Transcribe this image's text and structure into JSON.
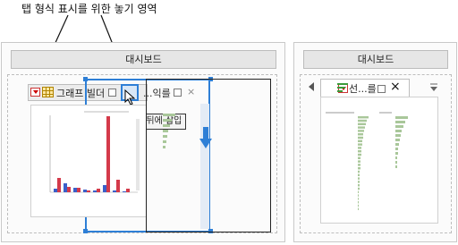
{
  "callout": {
    "text": "탭 형식 표시를 위한 놓기 영역"
  },
  "left_panel": {
    "title": "대시보드",
    "tab1_label": "그래프 빌더",
    "tab2_label": "...익를",
    "tooltip": "탭 뒤에 삽입"
  },
  "right_panel": {
    "title": "대시보드",
    "tab_label": "선...를"
  },
  "colors": {
    "bar_blue": "#3b5fc9",
    "bar_red": "#d43a4a",
    "accent": "#2e7fd6",
    "bar_green": "#a9c79a"
  }
}
